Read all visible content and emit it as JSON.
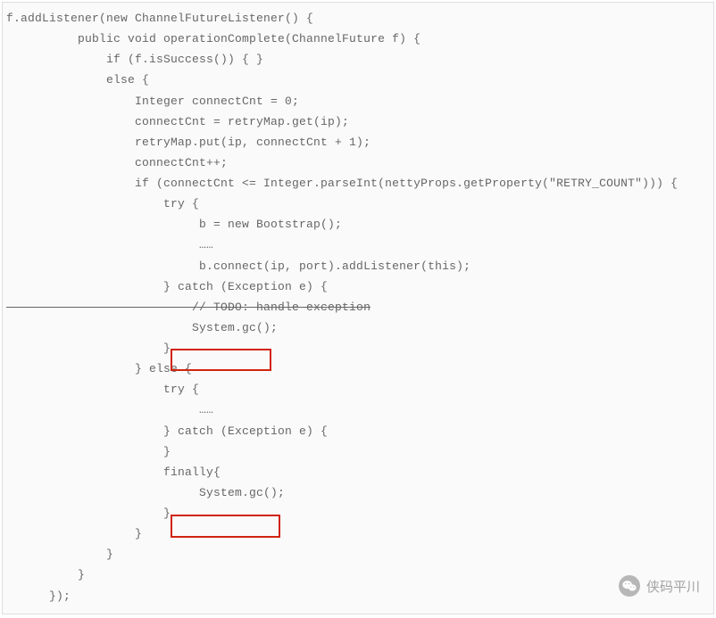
{
  "code": {
    "l1": "f.addListener(new ChannelFutureListener() {",
    "l2": "          public void operationComplete(ChannelFuture f) {",
    "l3": "              if (f.isSuccess()) { }",
    "l4": "              else {",
    "l5": "                  Integer connectCnt = 0;",
    "l6": "                  connectCnt = retryMap.get(ip);",
    "l7": "                  retryMap.put(ip, connectCnt + 1);",
    "l8": "                  connectCnt++;",
    "l9": "                  if (connectCnt <= Integer.parseInt(nettyProps.getProperty(\"RETRY_COUNT\"))) {",
    "l10": "                      try {",
    "l11": "                           b = new Bootstrap();",
    "l12": "                           ……",
    "l13": "                           b.connect(ip, port).addListener(this);",
    "l14": "                      } catch (Exception e) {",
    "l15": "                          // TODO: handle exception",
    "l16": "                          System.gc();",
    "l17": "                      }",
    "l18": "                  } else {",
    "l19": "                      try {",
    "l20": "                           ……",
    "l21": "                      } catch (Exception e) {",
    "l22": "                      }",
    "l23": "                      finally{",
    "l24": "                           System.gc();",
    "l25": "                      }",
    "l26": "                  }",
    "l27": "              }",
    "l28": "          }",
    "l29": "      });"
  },
  "highlights": {
    "h1_target": "System.gc();",
    "h2_target": "System.gc();",
    "color": "#d02410"
  },
  "watermark": {
    "text": "侠码平川",
    "icon": "wechat-icon"
  }
}
